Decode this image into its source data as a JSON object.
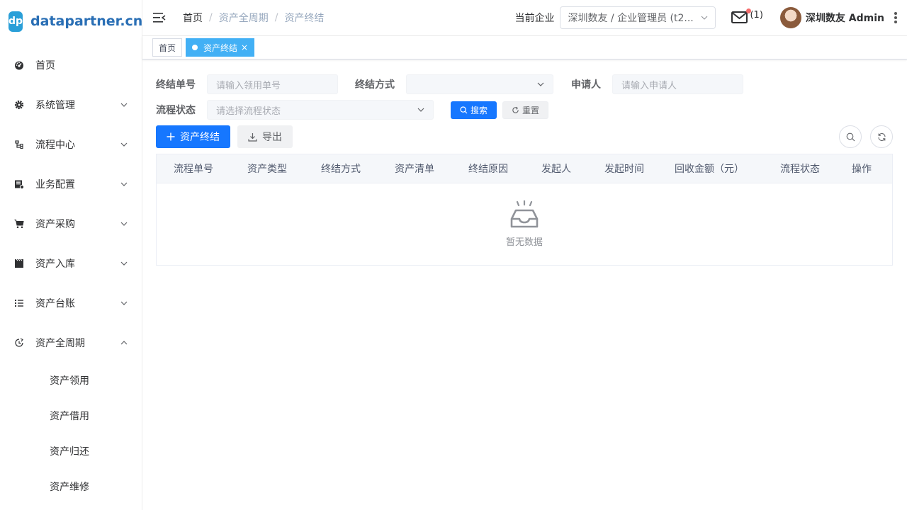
{
  "logo": {
    "badge": "dp",
    "text": "datapartner.cn"
  },
  "sidebar": {
    "items": [
      {
        "label": "首页",
        "icon": "dashboard-icon",
        "has_arrow": false
      },
      {
        "label": "系统管理",
        "icon": "gear-icon",
        "has_arrow": true
      },
      {
        "label": "流程中心",
        "icon": "flow-icon",
        "has_arrow": true
      },
      {
        "label": "业务配置",
        "icon": "config-icon",
        "has_arrow": true
      },
      {
        "label": "资产采购",
        "icon": "cart-icon",
        "has_arrow": true
      },
      {
        "label": "资产入库",
        "icon": "clapper-icon",
        "has_arrow": true
      },
      {
        "label": "资产台账",
        "icon": "list-icon",
        "has_arrow": true
      },
      {
        "label": "资产全周期",
        "icon": "cycle-icon",
        "has_arrow": true,
        "expanded": true
      }
    ],
    "subitems": [
      {
        "label": "资产领用"
      },
      {
        "label": "资产借用"
      },
      {
        "label": "资产归还"
      },
      {
        "label": "资产维修"
      }
    ]
  },
  "header": {
    "breadcrumb": [
      "首页",
      "资产全周期",
      "资产终结"
    ],
    "company_label": "当前企业",
    "company_value": "深圳数友 / 企业管理员 (t2...",
    "mail_count": "(1)",
    "user_name": "深圳数友 Admin"
  },
  "tags": [
    {
      "label": "首页",
      "active": false
    },
    {
      "label": "资产终结",
      "active": true,
      "close": "×"
    }
  ],
  "filters": {
    "end_no_label": "终结单号",
    "end_no_placeholder": "请输入领用单号",
    "end_method_label": "终结方式",
    "end_method_value": "",
    "applicant_label": "申请人",
    "applicant_placeholder": "请输入申请人",
    "status_label": "流程状态",
    "status_placeholder": "请选择流程状态",
    "search_label": "搜索",
    "reset_label": "重置"
  },
  "toolbar": {
    "add_label": "资产终结",
    "export_label": "导出"
  },
  "table": {
    "columns": [
      "流程单号",
      "资产类型",
      "终结方式",
      "资产清单",
      "终结原因",
      "发起人",
      "发起时间",
      "回收金额（元）",
      "流程状态",
      "操作"
    ],
    "empty_text": "暂无数据"
  },
  "colors": {
    "primary": "#1677ff",
    "tag_active": "#42b0f5",
    "logo_badge": "#2a9fd8",
    "notification_dot": "#f56c6c"
  }
}
